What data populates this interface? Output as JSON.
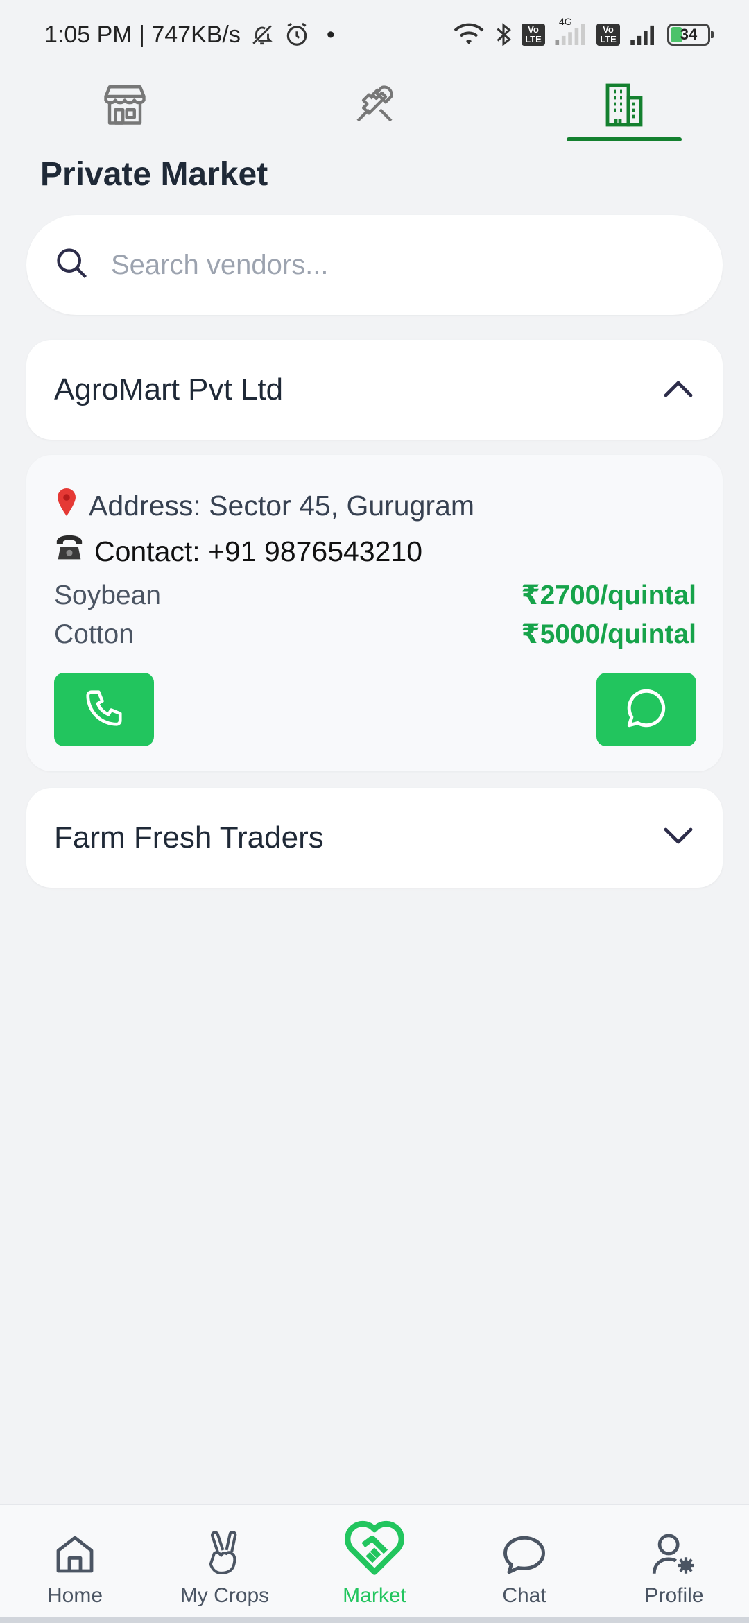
{
  "status_bar": {
    "time_speed": "1:05 PM | 747KB/s",
    "dot": "•",
    "network_4g": "4G",
    "volte1": "Vo LTE",
    "volte2": "Vo LTE",
    "battery": "34"
  },
  "top_tabs": [
    {
      "icon": "storefront-icon",
      "active": false
    },
    {
      "icon": "tools-icon",
      "active": false
    },
    {
      "icon": "building-icon",
      "active": true
    }
  ],
  "page": {
    "title": "Private Market",
    "search_placeholder": "Search vendors..."
  },
  "vendors": [
    {
      "name": "AgroMart Pvt Ltd",
      "expanded": true,
      "address_label": "Address: Sector 45, Gurugram",
      "contact_label": "Contact: +91 9876543210",
      "prices": [
        {
          "crop": "Soybean",
          "price": "₹2700/quintal"
        },
        {
          "crop": "Cotton",
          "price": "₹5000/quintal"
        }
      ]
    },
    {
      "name": "Farm Fresh Traders",
      "expanded": false
    }
  ],
  "bottom_nav": [
    {
      "label": "Home",
      "icon": "home-icon",
      "active": false
    },
    {
      "label": "My Crops",
      "icon": "peace-hand-icon",
      "active": false
    },
    {
      "label": "Market",
      "icon": "handshake-heart-icon",
      "active": true
    },
    {
      "label": "Chat",
      "icon": "chat-bubble-icon",
      "active": false
    },
    {
      "label": "Profile",
      "icon": "profile-settings-icon",
      "active": false
    }
  ],
  "colors": {
    "accent_green": "#22c55e",
    "price_green": "#16a34a",
    "tab_active": "#14802f"
  }
}
